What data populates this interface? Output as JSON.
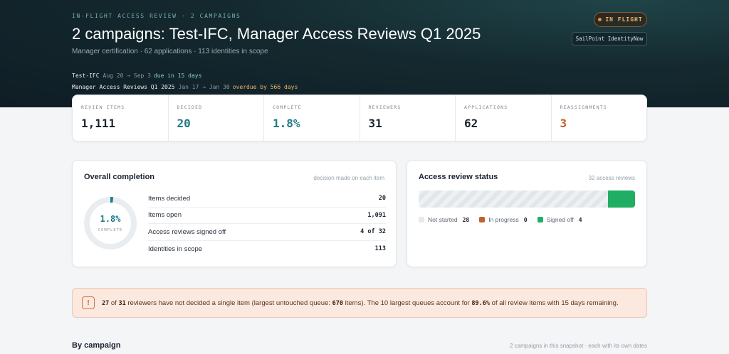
{
  "header": {
    "eyebrow": "IN-FLIGHT ACCESS REVIEW · 2 CAMPAIGNS",
    "title": "2 campaigns: Test-IFC, Manager Access Reviews Q1 2025",
    "subtitle": "Manager certification · 62 applications · 113 identities in scope",
    "status": "IN FLIGHT",
    "source": "SailPoint IdentityNow",
    "campaigns": [
      {
        "name": "Test-IFC",
        "dates": "Aug 20 → Sep 3",
        "note": "due in 15 days"
      },
      {
        "name": "Manager Access Reviews Q1 2025",
        "dates": "Jan 17 → Jan 30",
        "note": "overdue by 566 days"
      }
    ]
  },
  "kpis": [
    {
      "label": "REVIEW ITEMS",
      "value": "1,111"
    },
    {
      "label": "DECIDED",
      "value": "20"
    },
    {
      "label": "COMPLETE",
      "value": "1.8%"
    },
    {
      "label": "REVIEWERS",
      "value": "31"
    },
    {
      "label": "APPLICATIONS",
      "value": "62"
    },
    {
      "label": "REASSIGNMENTS",
      "value": "3"
    }
  ],
  "completion": {
    "title": "Overall completion",
    "note": "decision made on each item",
    "percent_label": "1.8%",
    "percent_value": 1.8,
    "center_caption": "COMPLETE",
    "rows": [
      {
        "label": "Items decided",
        "value": "20"
      },
      {
        "label": "Items open",
        "value": "1,091"
      },
      {
        "label": "Access reviews signed off",
        "value": "4 of 32"
      },
      {
        "label": "Identities in scope",
        "value": "113"
      }
    ]
  },
  "review_status": {
    "title": "Access review status",
    "note": "32 access reviews",
    "legend": [
      {
        "label": "Not started",
        "count": "28",
        "color": "#e6e9ec",
        "value": 28
      },
      {
        "label": "In progress",
        "count": "0",
        "color": "#c0622b",
        "value": 0
      },
      {
        "label": "Signed off",
        "count": "4",
        "color": "#1fae63",
        "value": 4
      }
    ]
  },
  "alert": {
    "icon": "!",
    "parts": {
      "a": "27",
      "b": " of ",
      "c": "31",
      "d": " reviewers have not decided a single item (largest untouched queue: ",
      "e": "670",
      "f": " items). The 10 largest queues account for ",
      "g": "89.6%",
      "h": " of all review items with 15 days remaining."
    }
  },
  "by_campaign": {
    "title": "By campaign",
    "note": "2 campaigns in this snapshot · each with its own dates"
  }
}
